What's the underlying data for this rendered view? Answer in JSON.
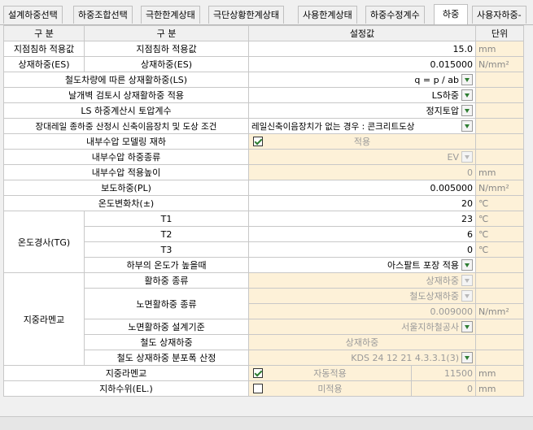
{
  "tabs": [
    "설계하중선택",
    "하중조합선택",
    "극한한계상태",
    "극단상황한계상태",
    "사용한계상태",
    "하중수정계수",
    "하중",
    "사용자하중-"
  ],
  "header": {
    "col1": "구  분",
    "col2": "구  분",
    "value": "설정값",
    "unit": "단위"
  },
  "rows": {
    "settle_group": "지점침하 적용값",
    "settle_label": "지점침하 적용값",
    "settle_value": "15.0",
    "settle_unit": "mm",
    "es_group": "상재하중(ES)",
    "es_label": "상재하중(ES)",
    "es_value": "0.015000",
    "es_unit": "N/mm²",
    "ls_label": "철도차량에 따른 상재활하중(LS)",
    "ls_value": "q = p / ab",
    "wing_label": "날개벽 검토시 상재활하중 적용",
    "wing_value": "LS하중",
    "earth_label": "LS 하중계산시 토압계수",
    "earth_value": "정지토압",
    "rail_label": "장대레일 종하중 산정시 신축이음장치 및 도상 조건",
    "rail_value": "레일신축이음장치가 없는 경우 : 콘크리트도상",
    "inner_label": "내부수압 모델링 재하",
    "inner_value": "적용",
    "inner_type_label": "내부수압 하중종류",
    "inner_type_value": "EV",
    "inner_height_label": "내부수압 적용높이",
    "inner_height_value": "0",
    "inner_height_unit": "mm",
    "pl_label": "보도하중(PL)",
    "pl_value": "0.005000",
    "pl_unit": "N/mm²",
    "temp_label": "온도변화차(±)",
    "temp_value": "20",
    "temp_unit": "℃",
    "tg_group": "온도경사(TG)",
    "t1_label": "T1",
    "t1_value": "23",
    "t1_unit": "℃",
    "t2_label": "T2",
    "t2_value": "6",
    "t2_unit": "℃",
    "t3_label": "T3",
    "t3_value": "0",
    "t3_unit": "℃",
    "bottom_temp_label": "하부의 온도가 높을때",
    "bottom_temp_value": "아스팔트 포장 적용",
    "rail_group": "지중라멘교",
    "live_type_label": "활하중 종류",
    "live_type_value": "상재하중",
    "surface_label": "노면활하중 종류",
    "surface_value": "철도상재하중",
    "surface_value2": "0.009000",
    "surface_unit": "N/mm²",
    "surface_std_label": "노면활하중 설계기준",
    "surface_std_value": "서울지하철공사",
    "rail_load_label": "철도 상재하중",
    "rail_load_value": "상재하중",
    "rail_dist_label": "철도 상재하중 분포폭 산정",
    "rail_dist_value": "KDS 24 12 21 4.3.3.1(3)",
    "underground_label": "지중라멘교",
    "underground_text": "자동적용",
    "underground_value": "11500",
    "underground_unit": "mm",
    "water_label": "지하수위(EL.)",
    "water_text": "미적용",
    "water_value": "0",
    "water_unit": "mm"
  }
}
